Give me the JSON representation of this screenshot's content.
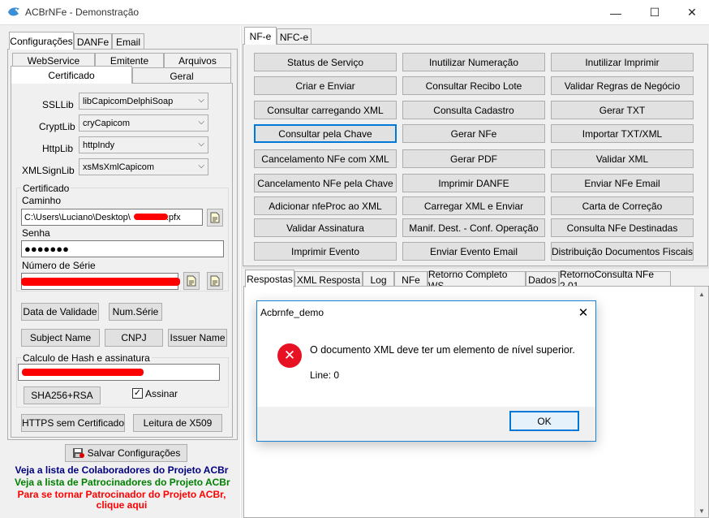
{
  "window": {
    "title": "ACBrNFe - Demonstração",
    "minimize": "—",
    "maximize": "☐",
    "close": "✕"
  },
  "left": {
    "top_tabs": [
      "Configurações",
      "DANFe",
      "Email"
    ],
    "sub_tabs_row1": [
      "WebService",
      "Emitente",
      "Arquivos"
    ],
    "sub_tabs_row2": [
      "Certificado",
      "Geral"
    ],
    "ssllib": {
      "label": "SSLLib",
      "value": "libCapicomDelphiSoap"
    },
    "cryptlib": {
      "label": "CryptLib",
      "value": "cryCapicom"
    },
    "httplib": {
      "label": "HttpLib",
      "value": "httpIndy"
    },
    "xmlsignlib": {
      "label": "XMLSignLib",
      "value": "xsMsXmlCapicom"
    },
    "certificado": {
      "group_label": "Certificado",
      "caminho_label": "Caminho",
      "caminho_value": "C:\\Users\\Luciano\\Desktop\\",
      "caminho_suffix": ".pfx",
      "senha_label": "Senha",
      "senha_value": "●●●●●●●",
      "numero_serie_label": "Número de Série"
    },
    "buttons": {
      "data_validade": "Data de Validade",
      "num_serie": "Num.Série",
      "subject_name": "Subject Name",
      "cnpj": "CNPJ",
      "issuer_name": "Issuer Name"
    },
    "hash": {
      "group_label": "Calculo de Hash e assinatura",
      "algorithm_button": "SHA256+RSA",
      "assinar_label": "Assinar",
      "assinar_checked": "✓"
    },
    "https_button": "HTTPS sem Certificado",
    "leitura_button": "Leitura de X509",
    "salvar_button": "Salvar Configurações",
    "links": {
      "colaboradores": "Veja a lista de Colaboradores do Projeto ACBr",
      "patrocinadores": "Veja a lista de Patrocinadores do Projeto ACBr",
      "tornar_line1": "Para se tornar Patrocinador do Projeto ACBr,",
      "tornar_line2": "clique aqui"
    },
    "colors": {
      "colaboradores": "#000080",
      "patrocinadores": "#008000",
      "tornar": "#ff0000"
    }
  },
  "right": {
    "tabs": [
      "NF-e",
      "NFC-e"
    ],
    "buttons": [
      [
        "Status de Serviço",
        "Inutilizar Numeração",
        "Inutilizar Imprimir"
      ],
      [
        "Criar e Enviar",
        "Consultar Recibo Lote",
        "Validar Regras de Negócio"
      ],
      [
        "Consultar carregando XML",
        "Consulta Cadastro",
        "Gerar TXT"
      ],
      [
        "Consultar pela Chave",
        "Gerar NFe",
        "Importar TXT/XML"
      ],
      [
        "Cancelamento NFe com XML",
        "Gerar PDF",
        "Validar XML"
      ],
      [
        "Cancelamento NFe pela Chave",
        "Imprimir DANFE",
        "Enviar NFe Email"
      ],
      [
        "Adicionar nfeProc ao XML",
        "Carregar XML e Enviar",
        "Carta de Correção"
      ],
      [
        "Validar Assinatura",
        "Manif. Dest. - Conf. Operação",
        "Consulta NFe Destinadas"
      ],
      [
        "Imprimir Evento",
        "Enviar Evento Email",
        "Distribuição Documentos Fiscais"
      ]
    ],
    "response_tabs": [
      "Respostas",
      "XML Resposta",
      "Log",
      "NFe",
      "Retorno Completo WS",
      "Dados",
      "RetornoConsulta NFe 2.01"
    ]
  },
  "dialog": {
    "title": "Acbrnfe_demo",
    "close": "✕",
    "message": "O documento XML deve ter um elemento de nível superior.",
    "line": "Line: 0",
    "ok": "OK",
    "error_icon_glyph": "✕",
    "error_color": "#e81123"
  }
}
